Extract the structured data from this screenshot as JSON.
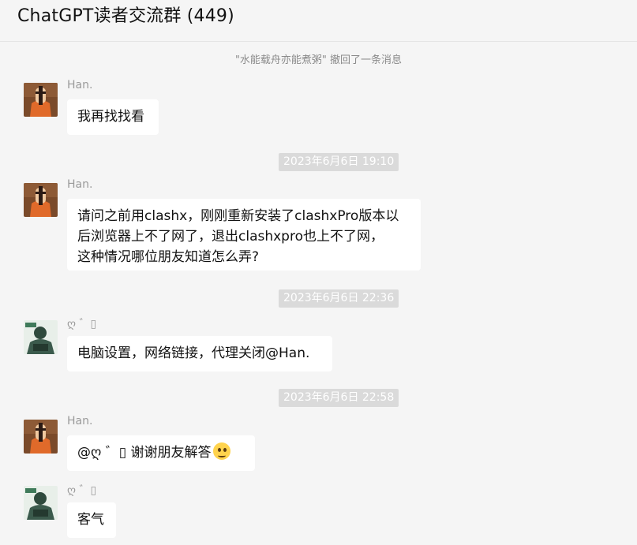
{
  "header": {
    "title": "ChatGPT读者交流群 (449)"
  },
  "notices": [
    {
      "text": "\"水能载舟亦能煮粥\" 撤回了一条消息"
    }
  ],
  "timestamps": [
    "2023年6月6日 19:10",
    "2023年6月6日 22:36",
    "2023年6月6日 22:58"
  ],
  "messages": [
    {
      "sender": "Han.",
      "lines": [
        "我再找找看"
      ]
    },
    {
      "sender": "Han.",
      "lines": [
        "请问之前用clashx，刚刚重新安装了clashxPro版本以",
        "后浏览器上不了网了，退出clashxpro也上不了网，",
        "这种情况哪位朋友知道怎么弄?"
      ]
    },
    {
      "sender": "ღ  ゛▯",
      "lines": [
        "电脑设置，网络链接，代理关闭@Han."
      ]
    },
    {
      "sender": "Han.",
      "lines": [
        "@ღ  ゛▯ 谢谢朋友解答"
      ],
      "emoji": "thinking-face-icon"
    },
    {
      "sender": "ღ  ゛▯",
      "lines": [
        "客气"
      ]
    }
  ]
}
